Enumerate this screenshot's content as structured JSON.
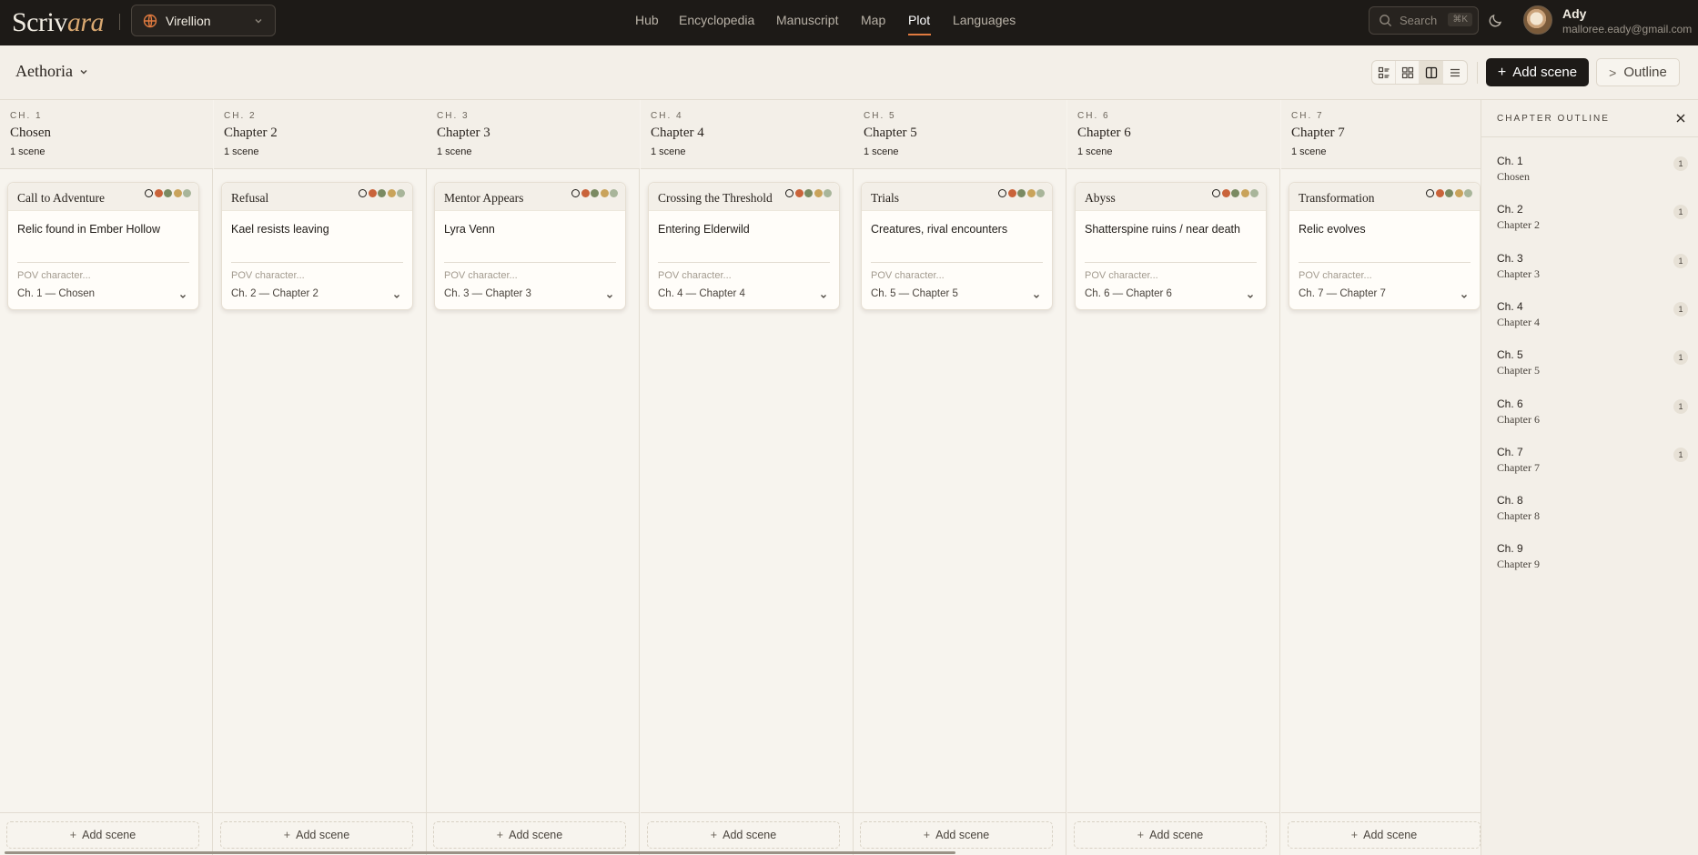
{
  "app": {
    "logo_main": "Scriv",
    "logo_accent": "ara",
    "world": "Virellion"
  },
  "nav": {
    "items": [
      {
        "label": "Hub",
        "active": false
      },
      {
        "label": "Encyclopedia",
        "active": false
      },
      {
        "label": "Manuscript",
        "active": false
      },
      {
        "label": "Map",
        "active": false
      },
      {
        "label": "Plot",
        "active": true
      },
      {
        "label": "Languages",
        "active": false
      }
    ]
  },
  "search": {
    "placeholder": "Search",
    "shortcut": "⌘K"
  },
  "user": {
    "name": "Ady",
    "email": "malloree.eady@gmail.com"
  },
  "toolbar": {
    "project": "Aethoria",
    "add_scene_label": "Add scene",
    "outline_label": "Outline",
    "views": [
      "list-detail-view",
      "grid-view",
      "board-view",
      "list-view"
    ],
    "active_view": "board-view"
  },
  "colors": {
    "accent": "#e07a3f",
    "dots": [
      "#1d1a17",
      "#c9633a",
      "#7a8a62",
      "#c9a35b",
      "#a8b59a"
    ]
  },
  "columns": [
    {
      "kicker": "CH. 1",
      "title": "Chosen",
      "count": "1 scene",
      "card": {
        "title": "Call to Adventure",
        "summary": "Relic found in Ember Hollow",
        "pov_placeholder": "POV character...",
        "chapter": "Ch. 1 — Chosen"
      }
    },
    {
      "kicker": "CH. 2",
      "title": "Chapter 2",
      "count": "1 scene",
      "card": {
        "title": "Refusal",
        "summary": "Kael resists leaving",
        "pov_placeholder": "POV character...",
        "chapter": "Ch. 2 — Chapter 2"
      }
    },
    {
      "kicker": "CH. 3",
      "title": "Chapter 3",
      "count": "1 scene",
      "card": {
        "title": "Mentor Appears",
        "summary": "Lyra Venn",
        "pov_placeholder": "POV character...",
        "chapter": "Ch. 3 — Chapter 3"
      }
    },
    {
      "kicker": "CH. 4",
      "title": "Chapter 4",
      "count": "1 scene",
      "card": {
        "title": "Crossing the Threshold",
        "summary": "Entering Elderwild",
        "pov_placeholder": "POV character...",
        "chapter": "Ch. 4 — Chapter 4"
      }
    },
    {
      "kicker": "CH. 5",
      "title": "Chapter 5",
      "count": "1 scene",
      "card": {
        "title": "Trials",
        "summary": "Creatures, rival encounters",
        "pov_placeholder": "POV character...",
        "chapter": "Ch. 5 — Chapter 5"
      }
    },
    {
      "kicker": "CH. 6",
      "title": "Chapter 6",
      "count": "1 scene",
      "card": {
        "title": "Abyss",
        "summary": "Shatterspine ruins / near death",
        "pov_placeholder": "POV character...",
        "chapter": "Ch. 6 — Chapter 6"
      }
    },
    {
      "kicker": "CH. 7",
      "title": "Chapter 7",
      "count": "1 scene",
      "card": {
        "title": "Transformation",
        "summary": "Relic evolves",
        "pov_placeholder": "POV character...",
        "chapter": "Ch. 7 — Chapter 7"
      }
    }
  ],
  "column_add_label": "Add scene",
  "outline": {
    "title": "CHAPTER OUTLINE",
    "items": [
      {
        "ch": "Ch. 1",
        "title": "Chosen",
        "count": "1"
      },
      {
        "ch": "Ch. 2",
        "title": "Chapter 2",
        "count": "1"
      },
      {
        "ch": "Ch. 3",
        "title": "Chapter 3",
        "count": "1"
      },
      {
        "ch": "Ch. 4",
        "title": "Chapter 4",
        "count": "1"
      },
      {
        "ch": "Ch. 5",
        "title": "Chapter 5",
        "count": "1"
      },
      {
        "ch": "Ch. 6",
        "title": "Chapter 6",
        "count": "1"
      },
      {
        "ch": "Ch. 7",
        "title": "Chapter 7",
        "count": "1"
      },
      {
        "ch": "Ch. 8",
        "title": "Chapter 8",
        "count": ""
      },
      {
        "ch": "Ch. 9",
        "title": "Chapter 9",
        "count": ""
      }
    ]
  }
}
